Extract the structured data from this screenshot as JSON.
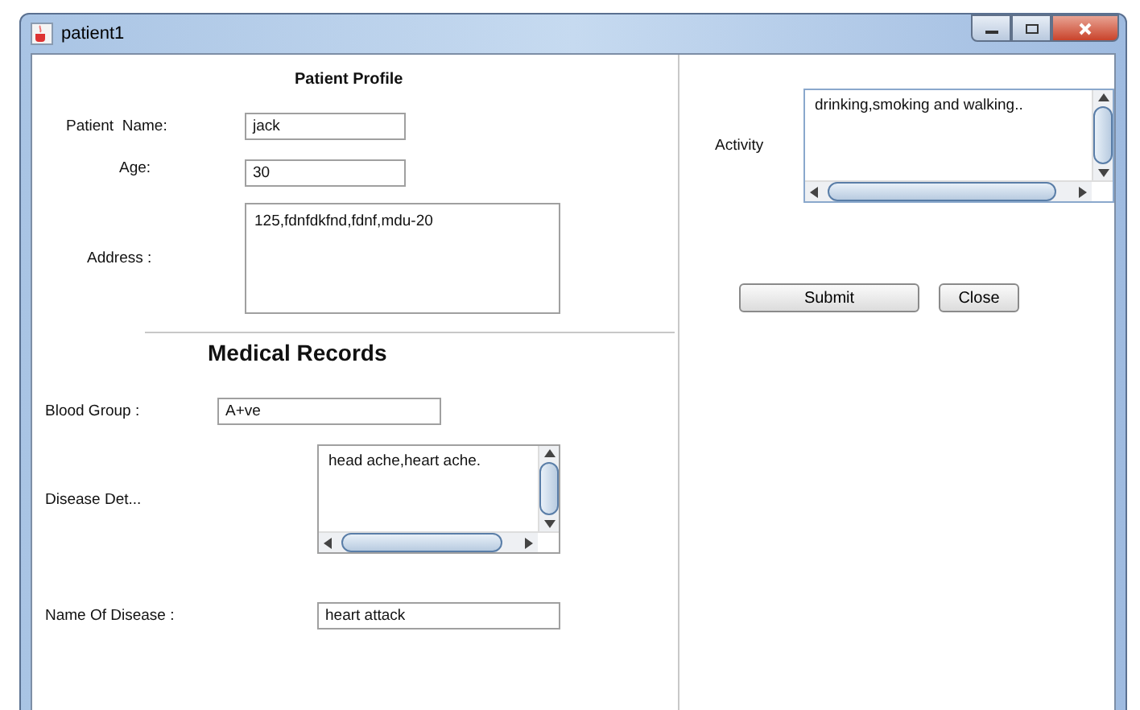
{
  "window": {
    "title": "patient1"
  },
  "profile": {
    "title": "Patient Profile",
    "fields": [
      {
        "kind": "text",
        "label": "Patient  Name:",
        "value": "jack"
      },
      {
        "kind": "text",
        "label": "Age:",
        "value": "30"
      },
      {
        "kind": "area",
        "label": "Address :",
        "value": "125,fdnfdkfnd,fdnf,mdu-20"
      }
    ]
  },
  "medical": {
    "title": "Medical Records",
    "fields": [
      {
        "kind": "text",
        "label": "Blood Group :",
        "value": "A+ve"
      },
      {
        "kind": "scroll",
        "label": "Disease Det...",
        "value": "head ache,heart ache."
      },
      {
        "kind": "text",
        "label": "Name Of Disease :",
        "value": "heart attack"
      }
    ]
  },
  "activity": {
    "kind": "scroll",
    "label": "Activity",
    "value": "drinking,smoking and walking.."
  },
  "buttons": [
    "Submit",
    "Close"
  ]
}
